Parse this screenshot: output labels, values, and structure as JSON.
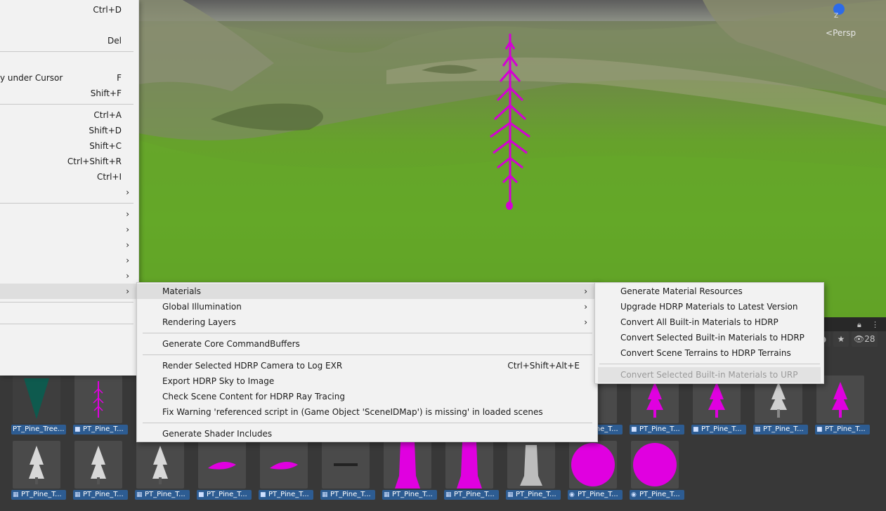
{
  "scene": {
    "camera_label": "Persp",
    "gizmo_axis": "Z"
  },
  "left_menu": {
    "items": [
      {
        "label": "",
        "shortcut": "Ctrl+D"
      },
      {
        "label": "",
        "shortcut": "Del"
      },
      {
        "label": "y under Cursor",
        "shortcut": "F"
      },
      {
        "label": "",
        "shortcut": "Shift+F"
      },
      {
        "label": "",
        "shortcut": "Ctrl+A"
      },
      {
        "label": "",
        "shortcut": "Shift+D"
      },
      {
        "label": "",
        "shortcut": "Shift+C"
      },
      {
        "label": "",
        "shortcut": "Ctrl+Shift+R"
      },
      {
        "label": "",
        "shortcut": "Ctrl+I"
      }
    ],
    "arrow": "›"
  },
  "hdrp_menu": {
    "materials": "Materials",
    "global_illumination": "Global Illumination",
    "rendering_layers": "Rendering Layers",
    "generate_core_commandbuffers": "Generate Core CommandBuffers",
    "render_selected_camera": "Render Selected HDRP Camera to Log EXR",
    "render_selected_camera_shortcut": "Ctrl+Shift+Alt+E",
    "export_sky": "Export HDRP Sky to Image",
    "check_scene": "Check Scene Content for HDRP Ray Tracing",
    "fix_warning": "Fix Warning 'referenced script in (Game Object 'SceneIDMap') is missing' in loaded scenes",
    "generate_shader_includes": "Generate Shader Includes"
  },
  "materials_menu": {
    "generate_resources": "Generate Material Resources",
    "upgrade": "Upgrade HDRP Materials to Latest Version",
    "convert_all": "Convert All Built-in Materials to HDRP",
    "convert_selected": "Convert Selected Built-in Materials to HDRP",
    "convert_terrains": "Convert Scene Terrains to HDRP Terrains",
    "convert_urp": "Convert Selected Built-in Materials to URP"
  },
  "project": {
    "visibility_count": "28",
    "assets_row1": [
      {
        "label": "PT_Pine_Tree...",
        "icon": "material-icon"
      },
      {
        "label": "PT_Pine_T...",
        "icon": "prefab-icon"
      },
      {
        "label": "PT_Pine_T...",
        "icon": "prefab-icon"
      },
      {
        "label": "PT_Pine_T...",
        "icon": "prefab-icon"
      },
      {
        "label": "PT_Pine_T...",
        "icon": "prefab-icon"
      },
      {
        "label": "PT_Pine_T...",
        "icon": "mesh-icon"
      },
      {
        "label": "PT_Pine_T...",
        "icon": "prefab-icon"
      }
    ],
    "assets_row2": [
      {
        "label": "PT_Pine_T...",
        "icon": "mesh-icon"
      },
      {
        "label": "PT_Pine_T...",
        "icon": "mesh-icon"
      },
      {
        "label": "PT_Pine_T...",
        "icon": "mesh-icon"
      },
      {
        "label": "PT_Pine_T...",
        "icon": "prefab-icon"
      },
      {
        "label": "PT_Pine_T...",
        "icon": "prefab-icon"
      },
      {
        "label": "PT_Pine_T...",
        "icon": "mesh-icon"
      },
      {
        "label": "PT_Pine_T...",
        "icon": "mesh-icon"
      },
      {
        "label": "PT_Pine_T...",
        "icon": "mesh-icon"
      },
      {
        "label": "PT_Pine_T...",
        "icon": "mesh-icon"
      },
      {
        "label": "PT_Pine_T...",
        "icon": "material-icon"
      },
      {
        "label": "PT_Pine_T...",
        "icon": "material-icon"
      }
    ]
  }
}
